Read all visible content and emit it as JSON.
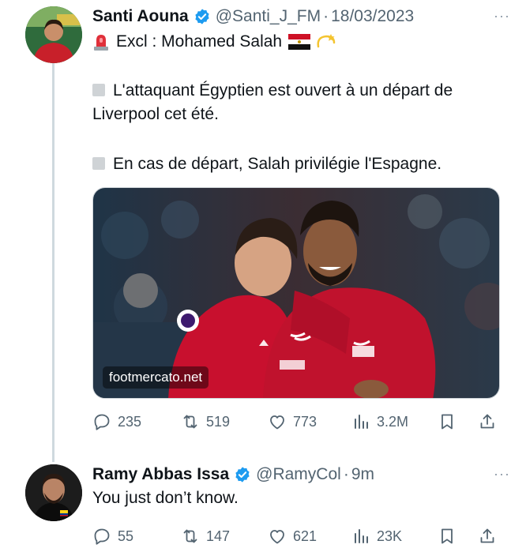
{
  "tweets": [
    {
      "author": {
        "name": "Santi Aouna",
        "handle": "@Santi_J_FM",
        "verified": true
      },
      "timestamp": "18/03/2023",
      "more_label": "···",
      "text": {
        "line1": "Excl : Mohamed Salah",
        "para2": "L'attaquant Égyptien est ouvert à un départ de Liverpool cet été.",
        "para3": "En cas de départ, Salah privilégie l'Espagne."
      },
      "media": {
        "watermark": "footmercato.net"
      },
      "metrics": {
        "replies": "235",
        "reposts": "519",
        "likes": "773",
        "views": "3.2M"
      }
    },
    {
      "author": {
        "name": "Ramy Abbas Issa",
        "handle": "@RamyCol",
        "verified": true
      },
      "timestamp": "9m",
      "more_label": "···",
      "text": "You just don’t know.",
      "metrics": {
        "replies": "55",
        "reposts": "147",
        "likes": "621",
        "views": "23K"
      }
    }
  ],
  "colors": {
    "muted": "#536471",
    "verified": "#1d9bf0",
    "thread_line": "#cfd9de",
    "liverpool_red": "#c8102e"
  },
  "icons": [
    "reply-icon",
    "repost-icon",
    "like-icon",
    "views-icon",
    "bookmark-icon",
    "share-icon",
    "verified-badge-icon",
    "siren-emoji-icon",
    "egypt-flag-icon",
    "dizzy-emoji-icon"
  ]
}
